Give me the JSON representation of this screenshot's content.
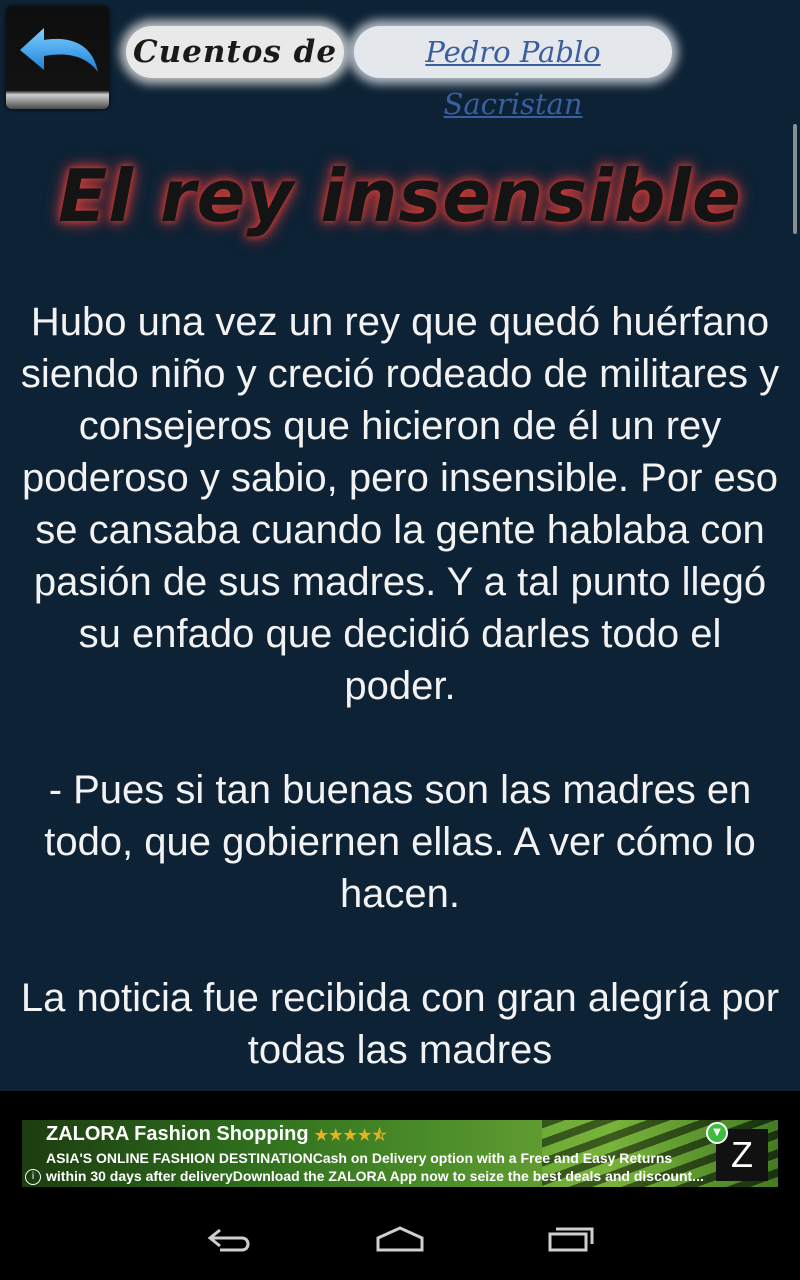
{
  "header": {
    "back_icon": "back-arrow-icon",
    "brand_part1": "Cuentos de",
    "brand_part2": "Pedro Pablo Sacristan"
  },
  "story": {
    "title": "El rey insensible",
    "paragraphs": [
      "Hubo una vez un rey que quedó huérfano siendo niño y creció rodeado de militares y consejeros que hicieron de él un rey poderoso y sabio, pero insensible. Por eso se cansaba cuando la gente hablaba con pasión de sus madres. Y a tal punto llegó su enfado que decidió darles todo el poder.",
      "- Pues si tan buenas son las madres en todo, que gobiernen ellas. A ver cómo lo hacen.",
      "La noticia fue recibida con gran alegría por todas las madres"
    ]
  },
  "ad": {
    "title": "ZALORA Fashion Shopping",
    "rating_stars": "★★★★⯪",
    "rating": 4.5,
    "line1": "ASIA'S ONLINE FASHION DESTINATIONCash on Delivery option with a Free and Easy Returns",
    "line2": "within 30 days after deliveryDownload the ZALORA App now to seize the best deals and discount...",
    "info_icon": "i",
    "logo_letter": "Z",
    "badge_icon": "download-badge-icon"
  },
  "navbar": {
    "back": "back-nav-icon",
    "home": "home-nav-icon",
    "recents": "recents-nav-icon"
  },
  "colors": {
    "background": "#0d2235",
    "title_glow": "#c03a38",
    "body_text": "#f2f2f2",
    "ad_green": "#4c8d2a"
  }
}
